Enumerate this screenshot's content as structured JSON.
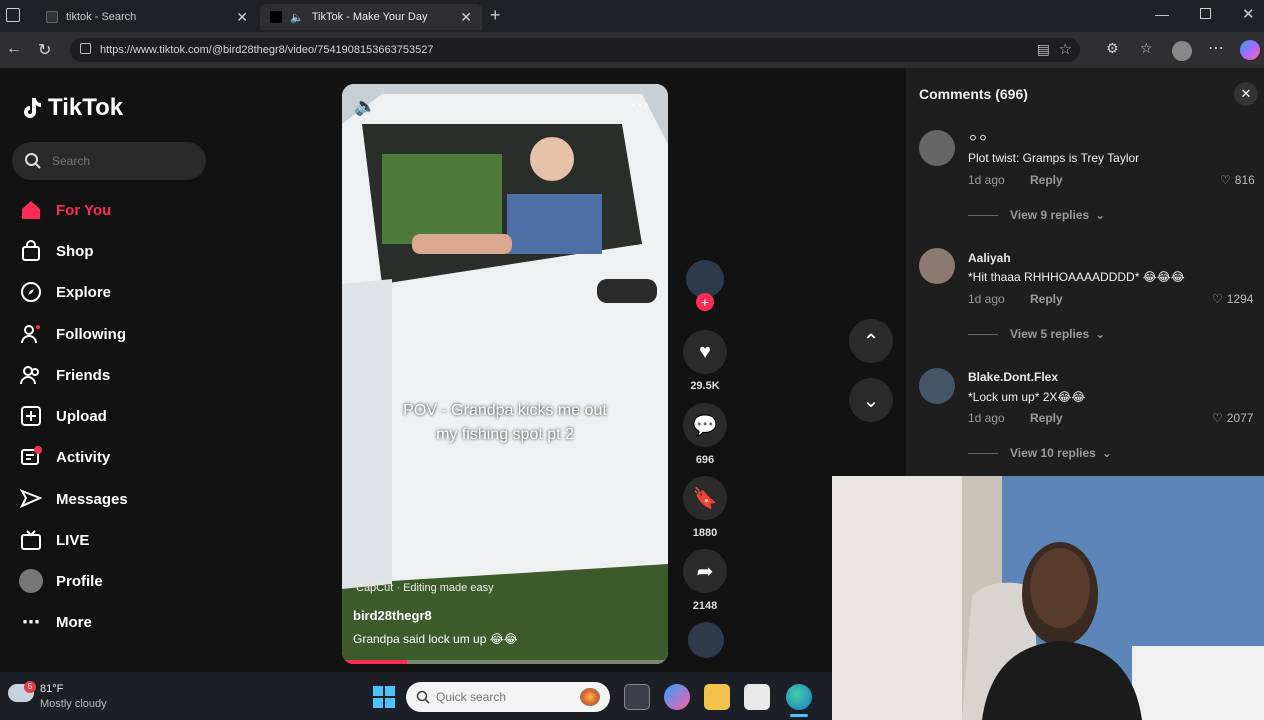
{
  "browser": {
    "tabs": [
      {
        "title": "tiktok - Search"
      },
      {
        "title": "TikTok - Make Your Day"
      }
    ],
    "url": "https://www.tiktok.com/@bird28thegr8/video/7541908153663753527"
  },
  "sidebar": {
    "logo": "TikTok",
    "search_placeholder": "Search",
    "items": [
      {
        "label": "For You",
        "icon": "home-icon"
      },
      {
        "label": "Shop",
        "icon": "shop-icon"
      },
      {
        "label": "Explore",
        "icon": "compass-icon"
      },
      {
        "label": "Following",
        "icon": "following-icon"
      },
      {
        "label": "Friends",
        "icon": "friends-icon"
      },
      {
        "label": "Upload",
        "icon": "upload-icon"
      },
      {
        "label": "Activity",
        "icon": "activity-icon"
      },
      {
        "label": "Messages",
        "icon": "messages-icon"
      },
      {
        "label": "LIVE",
        "icon": "live-icon"
      },
      {
        "label": "Profile",
        "icon": "profile-avatar"
      },
      {
        "label": "More",
        "icon": "more-icon"
      }
    ]
  },
  "video": {
    "overlay_text_line1": "POV - Grandpa kicks me out",
    "overlay_text_line2": "my fishing spot pt 2",
    "capcut_label": "CapCut · Editing made easy",
    "author": "bird28thegr8",
    "description": "Grandpa said lock um up 😂😂",
    "progress": 0.2
  },
  "actions": {
    "likes": "29.5K",
    "comments": "696",
    "saves": "1880",
    "shares": "2148"
  },
  "comments_panel": {
    "title": "Comments (696)",
    "comments": [
      {
        "name": "⚪⚪",
        "text": "Plot twist: Gramps is Trey Taylor",
        "time": "1d ago",
        "reply": "Reply",
        "likes": "816",
        "view_replies": "View 9 replies"
      },
      {
        "name": "Aaliyah",
        "text": "*Hit thaaa RHHHOAAAADDDD* 😂😂😂",
        "time": "1d ago",
        "reply": "Reply",
        "likes": "1294",
        "view_replies": "View 5 replies"
      },
      {
        "name": "Blake.Dont.Flex",
        "text": "*Lock um up* 2X😂😂",
        "time": "1d ago",
        "reply": "Reply",
        "likes": "2077",
        "view_replies": "View 10 replies"
      }
    ]
  },
  "taskbar": {
    "weather_temp": "81°F",
    "weather_desc": "Mostly cloudy",
    "weather_badge": "5",
    "search_placeholder": "Quick search"
  },
  "colors": {
    "accent": "#fe2c55",
    "panel": "#1e1e1e",
    "page": "#121212"
  }
}
